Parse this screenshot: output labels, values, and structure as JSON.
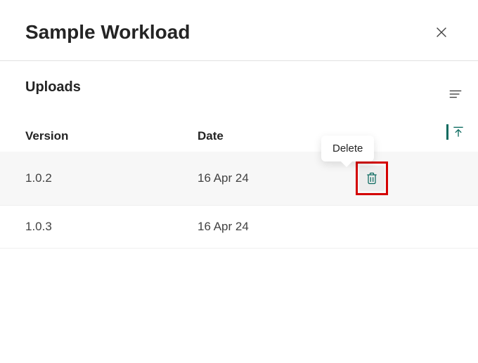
{
  "header": {
    "title": "Sample Workload"
  },
  "section": {
    "title": "Uploads"
  },
  "table": {
    "headers": {
      "version": "Version",
      "date": "Date"
    },
    "rows": [
      {
        "version": "1.0.2",
        "date": "16 Apr 24",
        "highlighted": true,
        "showDelete": true
      },
      {
        "version": "1.0.3",
        "date": "16 Apr 24",
        "highlighted": false,
        "showDelete": false
      }
    ]
  },
  "tooltip": {
    "delete": "Delete"
  },
  "colors": {
    "accent": "#0b6a5f",
    "highlight": "#d40000"
  }
}
